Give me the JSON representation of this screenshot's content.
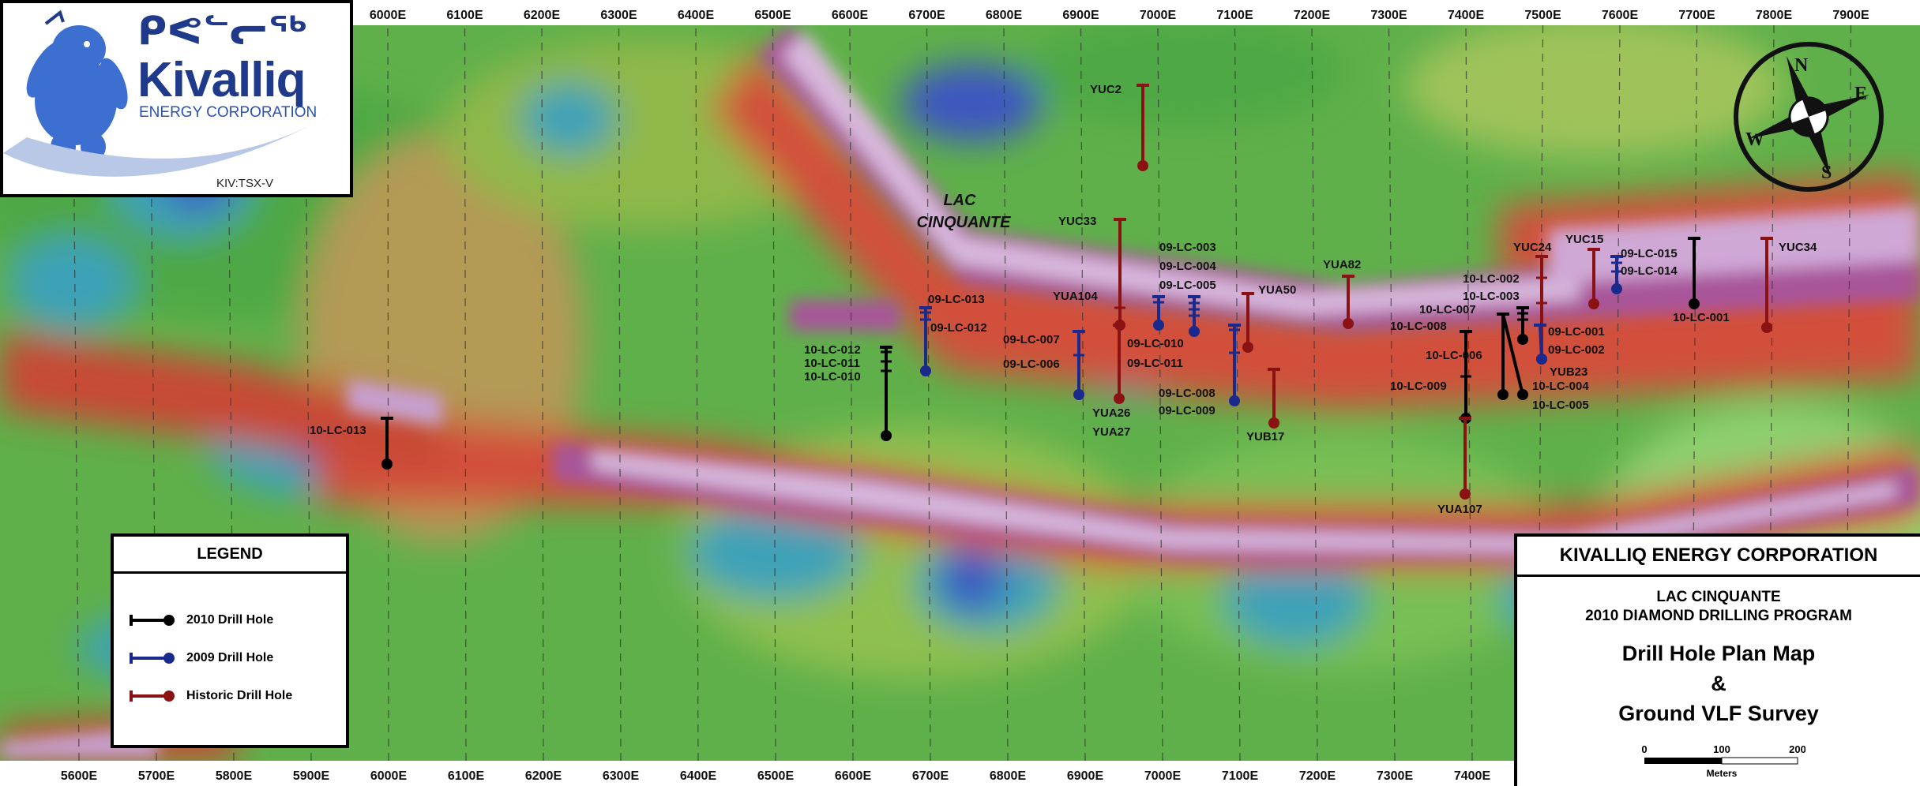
{
  "axis": {
    "top_ticks": [
      "6000E",
      "6100E",
      "6200E",
      "6300E",
      "6400E",
      "6500E",
      "6600E",
      "6700E",
      "6800E",
      "6900E",
      "7000E",
      "7100E",
      "7200E",
      "7300E",
      "7400E",
      "7500E",
      "7600E",
      "7700E",
      "7800E",
      "7900E"
    ],
    "bottom_ticks": [
      "5600E",
      "5700E",
      "5800E",
      "5900E",
      "6000E",
      "6100E",
      "6200E",
      "6300E",
      "6400E",
      "6500E",
      "6600E",
      "6700E",
      "6800E",
      "6900E",
      "7000E",
      "7100E",
      "7200E",
      "7300E",
      "7400E"
    ]
  },
  "logo": {
    "syllabics": "ᑭᕙᓪᓕᖅ",
    "name": "Kivalliq",
    "subtitle": "ENERGY CORPORATION",
    "ticker": "KIV:TSX-V"
  },
  "lake_label": [
    "LAC",
    "CINQUANTE"
  ],
  "legend": {
    "title": "LEGEND",
    "items": [
      {
        "label": "2010 Drill Hole",
        "color": "#000000"
      },
      {
        "label": "2009 Drill Hole",
        "color": "#1a2a8c"
      },
      {
        "label": "Historic Drill Hole",
        "color": "#8b1212"
      }
    ]
  },
  "title_block": {
    "company": "KIVALLIQ ENERGY CORPORATION",
    "project_line1": "LAC CINQUANTE",
    "project_line2": "2010 DIAMOND DRILLING PROGRAM",
    "main_line1": "Drill Hole Plan Map",
    "main_line2": "&",
    "main_line3": "Ground VLF Survey",
    "scale_labels": [
      "0",
      "100",
      "200"
    ],
    "scale_unit": "Meters"
  },
  "compass_letters": [
    "N",
    "E",
    "S",
    "W"
  ],
  "drill_labels": [
    "YUC2",
    "YUC33",
    "YUA104",
    "YUA26",
    "YUA27",
    "09-LC-003",
    "09-LC-004",
    "09-LC-005",
    "YUA50",
    "YUA82",
    "09-LC-013",
    "09-LC-012",
    "10-LC-012",
    "10-LC-011",
    "10-LC-010",
    "09-LC-007",
    "09-LC-006",
    "09-LC-010",
    "09-LC-011",
    "09-LC-008",
    "09-LC-009",
    "YUB17",
    "10-LC-013",
    "10-LC-002",
    "10-LC-003",
    "10-LC-007",
    "10-LC-008",
    "10-LC-006",
    "10-LC-009",
    "YUA107",
    "YUC24",
    "YUC15",
    "09-LC-015",
    "09-LC-014",
    "10-LC-001",
    "YUC34",
    "09-LC-001",
    "09-LC-002",
    "YUB23",
    "10-LC-004",
    "10-LC-005"
  ]
}
